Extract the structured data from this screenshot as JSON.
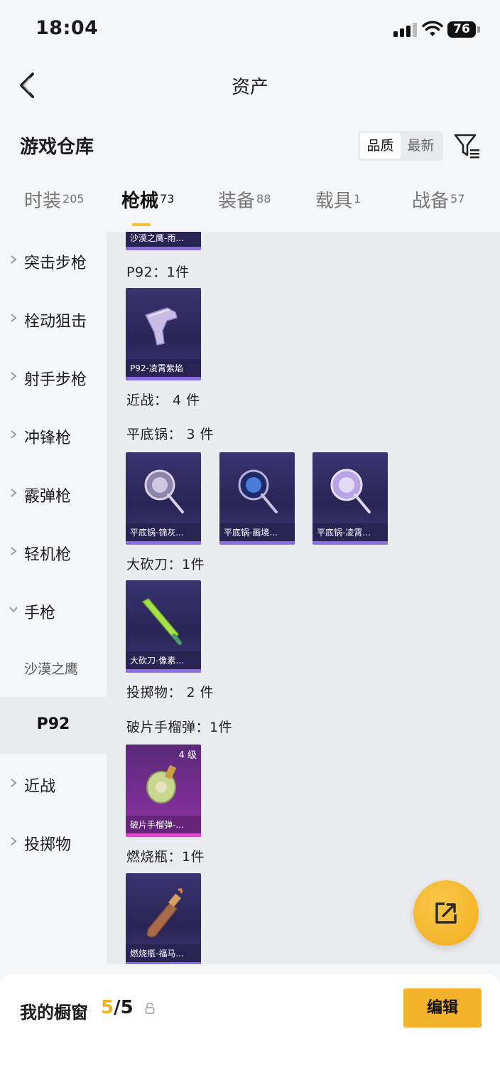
{
  "status_bar": {
    "time": "18:04",
    "battery": "76"
  },
  "nav": {
    "title": "资产"
  },
  "header": {
    "title": "游戏仓库",
    "sort_options": [
      "品质",
      "最新"
    ]
  },
  "tabs": [
    {
      "label": "时装",
      "count": "205"
    },
    {
      "label": "枪械",
      "count": "73"
    },
    {
      "label": "装备",
      "count": "88"
    },
    {
      "label": "载具",
      "count": "1"
    },
    {
      "label": "战备",
      "count": "57"
    }
  ],
  "sidebar": {
    "categories": [
      "突击步枪",
      "栓动狙击",
      "射手步枪",
      "冲锋枪",
      "霰弹枪",
      "轻机枪",
      "手枪"
    ],
    "subcategories": [
      "沙漠之鹰",
      "P92"
    ],
    "categories_after": [
      "近战",
      "投掷物"
    ]
  },
  "content": {
    "groups": [
      {
        "label": "P92：1件"
      },
      {
        "label": "近战： 4 件"
      },
      {
        "label": "平底锅： 3 件"
      },
      {
        "label": "大砍刀：1件"
      },
      {
        "label": "投掷物： 2 件"
      },
      {
        "label": "破片手榴弹：1件"
      },
      {
        "label": "燃烧瓶：1件"
      }
    ],
    "items": [
      {
        "name": "沙漠之鹰-雨..."
      },
      {
        "name": "P92-凌霄紫焰"
      },
      {
        "name": "平底锅-锦灰..."
      },
      {
        "name": "平底锅-画境..."
      },
      {
        "name": "平底锅-凌霄..."
      },
      {
        "name": "大砍刀-像素..."
      },
      {
        "name": "破片手榴弹-...",
        "level": "4 级"
      },
      {
        "name": "燃烧瓶-福马..."
      }
    ]
  },
  "bottom": {
    "label": "我的橱窗",
    "current": "5",
    "total": "/5",
    "edit": "编辑"
  },
  "colors": {
    "accent": "#f2b32a",
    "card_bg": "#2e2a5c",
    "card_rare": "#8a6ee0",
    "card_epic": "#e04ad0"
  },
  "icons": [
    "signal-icon",
    "wifi-icon",
    "battery-icon",
    "back-icon",
    "filter-icon",
    "chevron-right-icon",
    "chevron-down-icon",
    "share-icon",
    "lock-icon"
  ]
}
